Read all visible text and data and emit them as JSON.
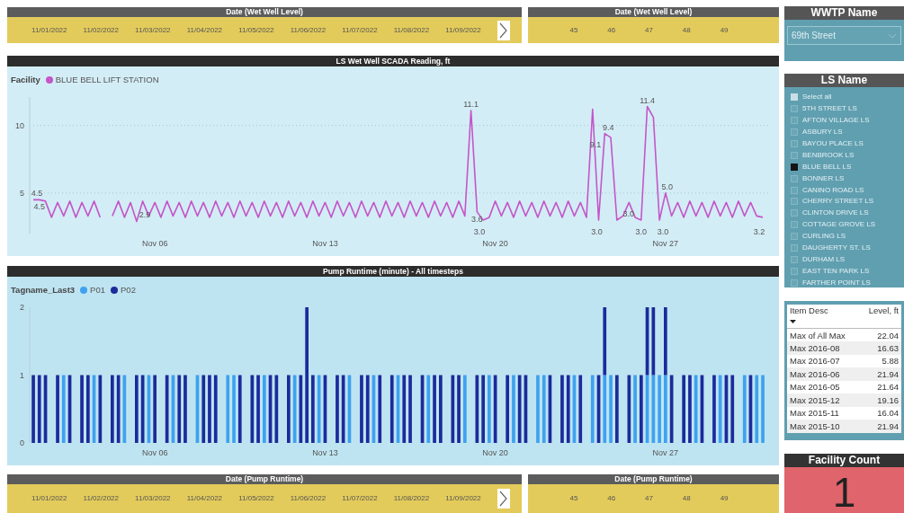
{
  "top_slicers": {
    "date": {
      "title": "Date (Wet Well Level)",
      "options": [
        "11/01/2022",
        "11/02/2022",
        "11/03/2022",
        "11/04/2022",
        "11/05/2022",
        "11/06/2022",
        "11/07/2022",
        "11/08/2022",
        "11/09/2022"
      ]
    },
    "week": {
      "title": "Date (Wet Well Level)",
      "options": [
        "45",
        "46",
        "47",
        "48",
        "49"
      ]
    }
  },
  "wet_well_chart": {
    "title": "LS Wet Well SCADA Reading, ft",
    "legend_title": "Facility",
    "chart_data": {
      "type": "line",
      "ylim": [
        2.0,
        12.1
      ],
      "yticks": [
        5,
        10
      ],
      "categories": [
        null,
        null,
        null,
        null,
        null,
        null,
        null,
        null,
        null,
        null,
        null,
        null,
        null,
        null,
        null,
        null,
        null,
        null,
        null,
        null,
        "Nov 06",
        null,
        null,
        null,
        null,
        null,
        null,
        null,
        null,
        null,
        null,
        null,
        null,
        null,
        null,
        null,
        null,
        null,
        null,
        null,
        null,
        null,
        null,
        null,
        null,
        null,
        null,
        null,
        "Nov 13",
        null,
        null,
        null,
        null,
        null,
        null,
        null,
        null,
        null,
        null,
        null,
        null,
        null,
        null,
        null,
        null,
        null,
        null,
        null,
        null,
        null,
        null,
        null,
        null,
        null,
        null,
        null,
        "Nov 20",
        null,
        null,
        null,
        null,
        null,
        null,
        null,
        null,
        null,
        null,
        null,
        null,
        null,
        null,
        null,
        null,
        null,
        null,
        null,
        null,
        null,
        null,
        null,
        null,
        null,
        null,
        null,
        "Nov 27",
        null,
        null,
        null,
        null,
        null,
        null,
        null,
        null,
        null,
        null,
        null,
        null,
        null,
        null,
        null,
        null
      ],
      "series": [
        {
          "name": "BLUE BELL LIFT STATION",
          "color": "#c456c8",
          "values": [
            4.5,
            4.5,
            4.4,
            3.2,
            4.3,
            3.3,
            4.4,
            3.2,
            4.3,
            3.3,
            4.4,
            3.2,
            null,
            3.3,
            4.4,
            3.2,
            4.3,
            2.9,
            4.4,
            3.3,
            4.3,
            3.2,
            4.4,
            3.3,
            4.3,
            3.2,
            4.4,
            3.3,
            4.3,
            3.2,
            4.4,
            3.3,
            4.3,
            3.2,
            4.4,
            3.3,
            4.3,
            3.2,
            4.4,
            3.3,
            4.3,
            3.2,
            4.4,
            3.3,
            4.3,
            3.2,
            4.4,
            3.3,
            4.3,
            3.2,
            4.4,
            3.3,
            4.3,
            3.2,
            4.4,
            3.3,
            4.3,
            3.2,
            4.4,
            3.3,
            4.3,
            3.2,
            4.4,
            3.3,
            4.3,
            3.2,
            4.4,
            3.3,
            4.3,
            3.2,
            4.4,
            3.3,
            11.1,
            3.6,
            3.0,
            3.2,
            4.4,
            3.3,
            4.3,
            3.2,
            4.4,
            3.3,
            4.3,
            3.2,
            4.4,
            3.3,
            4.3,
            3.2,
            4.4,
            3.3,
            4.3,
            3.2,
            11.2,
            3.0,
            9.4,
            9.1,
            3.0,
            3.3,
            4.3,
            3.2,
            3.0,
            11.4,
            10.6,
            3.0,
            5.0,
            3.3,
            4.3,
            3.2,
            4.4,
            3.3,
            4.3,
            3.2,
            4.4,
            3.3,
            4.3,
            3.2,
            4.4,
            3.3,
            4.3,
            3.3,
            3.2
          ]
        }
      ],
      "annotations": [
        "4.5",
        "4.5",
        "2.9",
        "11.1",
        "3.6",
        "3.0",
        "9.4",
        "9.1",
        "3.0",
        "3.0",
        "3.0",
        "11.4",
        "5.0",
        "3.0",
        "3.2"
      ]
    }
  },
  "pump_chart": {
    "title": "Pump Runtime (minute) - All timesteps",
    "legend_title": "Tagname_Last3",
    "chart_data": {
      "type": "bar",
      "stacked": true,
      "ylim": [
        0,
        2
      ],
      "yticks": [
        0,
        1,
        2
      ],
      "categories": [
        null,
        null,
        null,
        null,
        null,
        null,
        null,
        null,
        null,
        null,
        null,
        null,
        null,
        null,
        null,
        null,
        null,
        null,
        null,
        null,
        "Nov 06",
        null,
        null,
        null,
        null,
        null,
        null,
        null,
        null,
        null,
        null,
        null,
        null,
        null,
        null,
        null,
        null,
        null,
        null,
        null,
        null,
        null,
        null,
        null,
        null,
        null,
        null,
        null,
        "Nov 13",
        null,
        null,
        null,
        null,
        null,
        null,
        null,
        null,
        null,
        null,
        null,
        null,
        null,
        null,
        null,
        null,
        null,
        null,
        null,
        null,
        null,
        null,
        null,
        null,
        null,
        null,
        null,
        "Nov 20",
        null,
        null,
        null,
        null,
        null,
        null,
        null,
        null,
        null,
        null,
        null,
        null,
        null,
        null,
        null,
        null,
        null,
        null,
        null,
        null,
        null,
        null,
        null,
        null,
        null,
        null,
        null,
        "Nov 27",
        null,
        null,
        null,
        null,
        null,
        null,
        null,
        null,
        null,
        null,
        null,
        null,
        null,
        null,
        null,
        null
      ],
      "series": [
        {
          "name": "P01",
          "color": "#3ea2ef",
          "values": [
            0,
            0,
            0,
            0,
            0,
            1,
            0,
            0,
            0,
            0,
            1,
            0,
            0,
            0,
            0,
            1,
            0,
            0,
            0,
            1,
            0,
            0,
            0,
            1,
            0,
            0,
            0,
            1,
            0,
            0,
            0,
            0,
            1,
            1,
            0,
            0,
            0,
            0,
            1,
            0,
            0,
            0,
            0,
            1,
            0,
            0,
            0,
            1,
            0,
            0,
            0,
            0,
            1,
            0,
            0,
            0,
            1,
            0,
            0,
            0,
            1,
            0,
            0,
            0,
            0,
            1,
            0,
            0,
            0,
            0,
            0,
            1,
            0,
            0,
            0,
            1,
            0,
            0,
            0,
            1,
            0,
            0,
            0,
            1,
            1,
            0,
            0,
            0,
            0,
            1,
            0,
            0,
            1,
            0,
            1,
            1,
            0,
            0,
            0,
            1,
            0,
            1,
            1,
            1,
            1,
            0,
            0,
            0,
            0,
            1,
            0,
            0,
            0,
            1,
            0,
            0,
            0,
            1,
            0,
            1,
            1
          ]
        },
        {
          "name": "P02",
          "color": "#1b2b9c",
          "values": [
            1,
            1,
            1,
            0,
            1,
            0,
            1,
            0,
            1,
            1,
            0,
            1,
            0,
            1,
            1,
            0,
            0,
            1,
            1,
            0,
            1,
            0,
            1,
            0,
            1,
            1,
            0,
            0,
            1,
            1,
            1,
            0,
            0,
            0,
            1,
            0,
            1,
            1,
            0,
            1,
            1,
            0,
            1,
            0,
            1,
            2,
            1,
            0,
            1,
            0,
            1,
            1,
            0,
            0,
            1,
            1,
            0,
            1,
            0,
            1,
            0,
            1,
            1,
            0,
            1,
            0,
            1,
            1,
            0,
            1,
            1,
            0,
            0,
            1,
            1,
            0,
            1,
            0,
            1,
            0,
            1,
            1,
            0,
            0,
            0,
            1,
            0,
            1,
            1,
            0,
            1,
            0,
            0,
            1,
            1,
            0,
            1,
            0,
            1,
            0,
            1,
            1,
            1,
            0,
            1,
            1,
            0,
            1,
            1,
            0,
            1,
            0,
            1,
            0,
            1,
            1,
            0,
            0,
            1,
            0,
            0
          ]
        }
      ]
    }
  },
  "bottom_slicers": {
    "date": {
      "title": "Date (Pump Runtime)",
      "options": [
        "11/01/2022",
        "11/02/2022",
        "11/03/2022",
        "11/04/2022",
        "11/05/2022",
        "11/06/2022",
        "11/07/2022",
        "11/08/2022",
        "11/09/2022"
      ]
    },
    "week": {
      "title": "Date (Pump Runtime)",
      "options": [
        "45",
        "46",
        "47",
        "48",
        "49"
      ]
    }
  },
  "wwtp_filter": {
    "title": "WWTP Name",
    "value": "69th Street"
  },
  "ls_filter": {
    "title": "LS Name",
    "select_all": {
      "label": "Select all",
      "partial": true
    },
    "items": [
      {
        "label": "5TH STREET LS",
        "checked": false
      },
      {
        "label": "AFTON VILLAGE LS",
        "checked": false
      },
      {
        "label": "ASBURY LS",
        "checked": false
      },
      {
        "label": "BAYOU PLACE LS",
        "checked": false
      },
      {
        "label": "BENBROOK LS",
        "checked": false
      },
      {
        "label": "BLUE BELL LS",
        "checked": true
      },
      {
        "label": "BONNER LS",
        "checked": false
      },
      {
        "label": "CANINO ROAD LS",
        "checked": false
      },
      {
        "label": "CHERRY STREET LS",
        "checked": false
      },
      {
        "label": "CLINTON DRIVE LS",
        "checked": false
      },
      {
        "label": "COTTAGE GROVE LS",
        "checked": false
      },
      {
        "label": "CURLING LS",
        "checked": false
      },
      {
        "label": "DAUGHERTY ST. LS",
        "checked": false
      },
      {
        "label": "DURHAM LS",
        "checked": false
      },
      {
        "label": "EAST TEN PARK LS",
        "checked": false
      },
      {
        "label": "FARTHER POINT LS",
        "checked": false
      }
    ]
  },
  "level_table": {
    "columns": [
      {
        "label": "Item Desc",
        "sorted": true
      },
      {
        "label": "Level, ft",
        "sorted": false
      }
    ],
    "rows": [
      [
        "Max of All Max",
        "22.04"
      ],
      [
        "Max 2016-08",
        "16.63"
      ],
      [
        "Max 2016-07",
        "5.88"
      ],
      [
        "Max 2016-06",
        "21.94"
      ],
      [
        "Max 2016-05",
        "21.64"
      ],
      [
        "Max 2015-12",
        "19.16"
      ],
      [
        "Max 2015-11",
        "16.04"
      ],
      [
        "Max 2015-10",
        "21.94"
      ]
    ]
  },
  "facility_count": {
    "title": "Facility Count",
    "value": "1"
  }
}
